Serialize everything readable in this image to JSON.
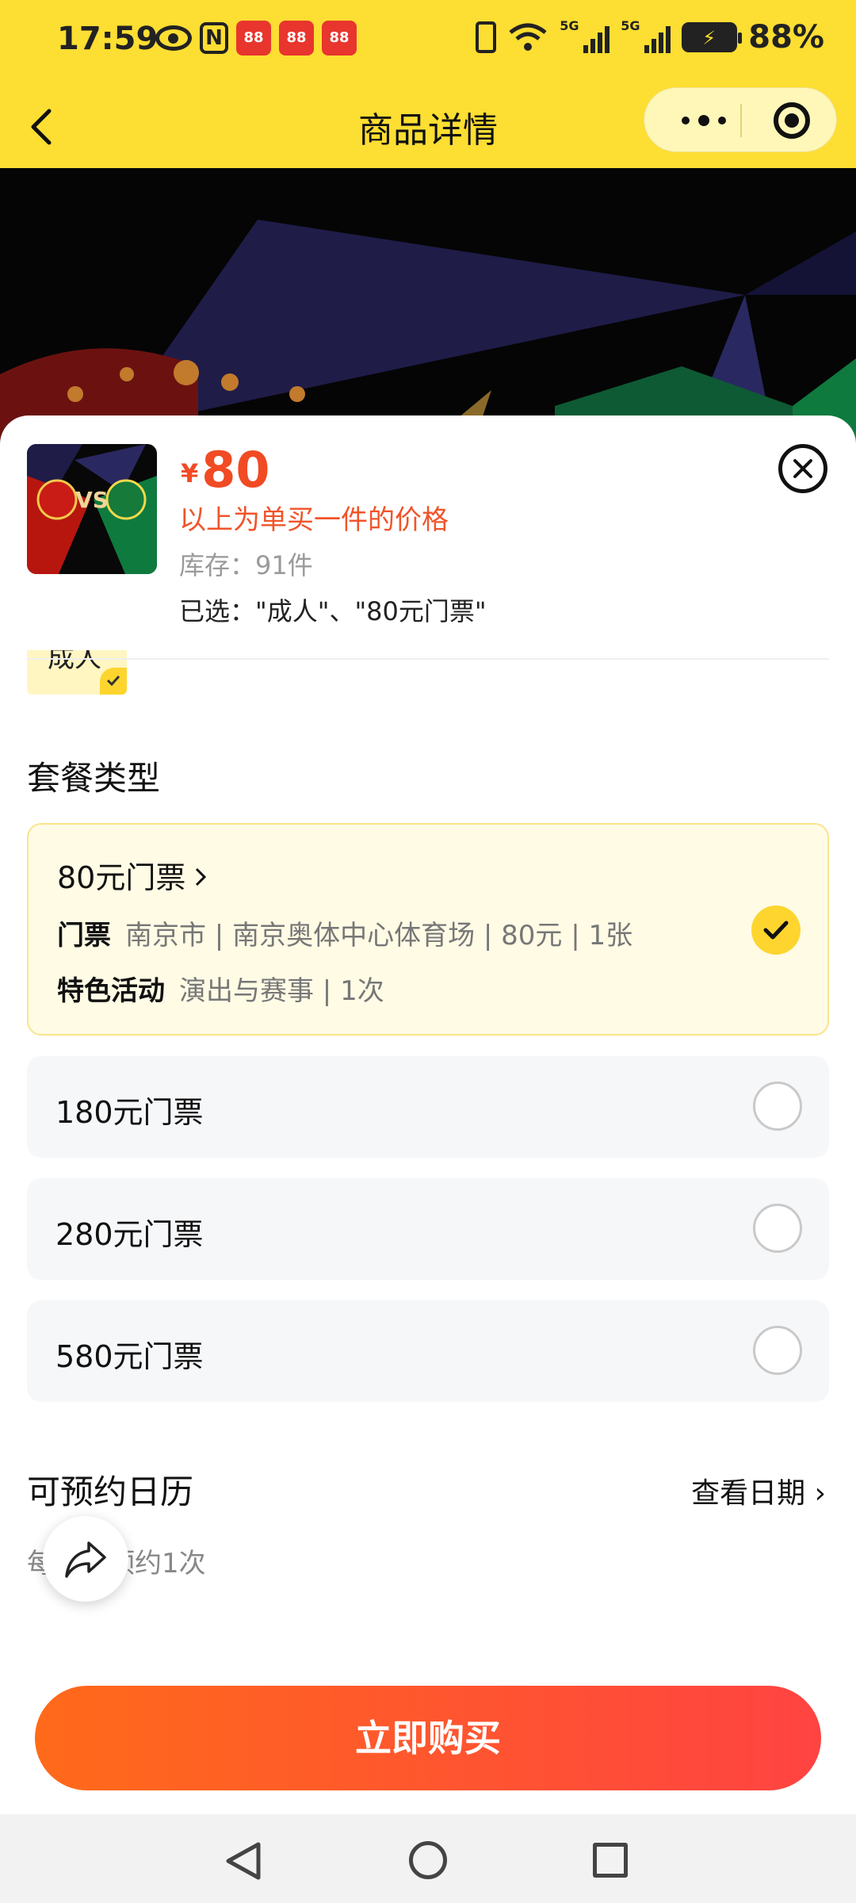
{
  "status_bar": {
    "time": "17:59",
    "app_badge": "88",
    "network_1": "5G",
    "network_2": "5G",
    "battery": "88%"
  },
  "title_bar": {
    "title": "商品详情"
  },
  "product": {
    "currency": "¥",
    "price": "80",
    "price_note": "以上为单买一件的价格",
    "stock": "库存：91件",
    "selected": "已选：\"成人\"、\"80元门票\"",
    "thumb_vs": "VS"
  },
  "person_chip": {
    "label": "成人"
  },
  "package": {
    "section_title": "套餐类型",
    "options": [
      {
        "name": "80元门票",
        "selected": true,
        "details": [
          {
            "label": "门票",
            "value": "南京市 | 南京奥体中心体育场 | 80元 | 1张"
          },
          {
            "label": "特色活动",
            "value": "演出与赛事 | 1次"
          }
        ]
      },
      {
        "name": "180元门票",
        "selected": false
      },
      {
        "name": "280元门票",
        "selected": false
      },
      {
        "name": "580元门票",
        "selected": false
      }
    ]
  },
  "calendar": {
    "title": "可预约日历",
    "link": "查看日期 ›",
    "note": "每人限预约1次"
  },
  "buy_button": "立即购买",
  "colors": {
    "accent_yellow": "#FDDE32",
    "price_red": "#F04B24",
    "buy_gradient_start": "#FF6A1A",
    "buy_gradient_end": "#FF4342"
  }
}
